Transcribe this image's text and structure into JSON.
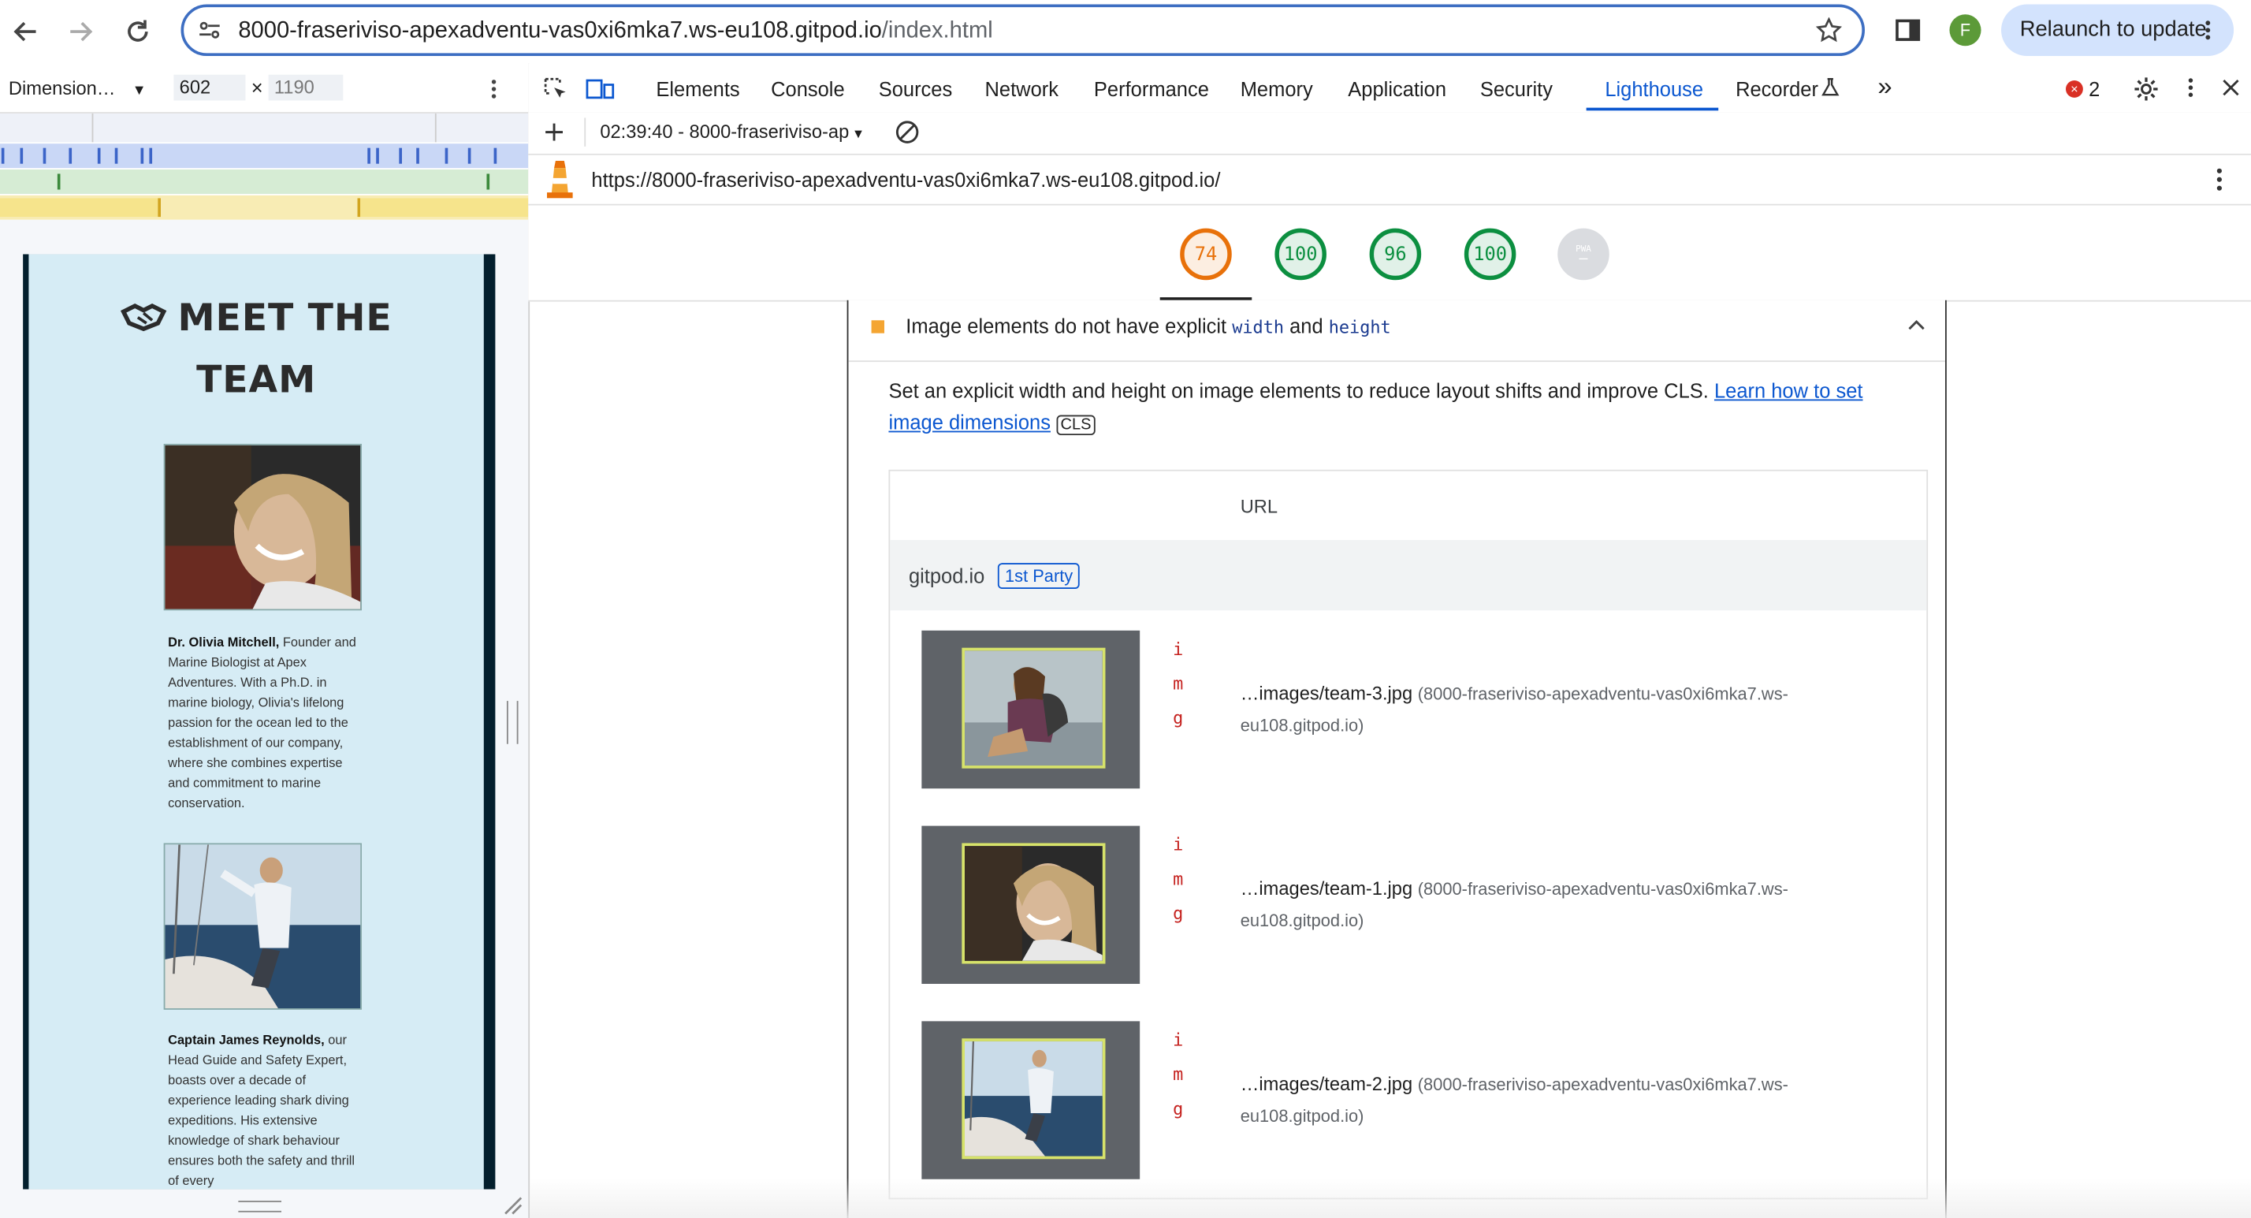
{
  "browser": {
    "url_host": "8000-fraseriviso-apexadventu-vas0xi6mka7.ws-eu108.gitpod.io",
    "url_path": "/index.html",
    "avatar_letter": "F",
    "relaunch_label": "Relaunch to update"
  },
  "device_toolbar": {
    "preset": "Dimension…",
    "width": "602",
    "times": "×",
    "height": "1190"
  },
  "devtools": {
    "tabs": [
      "Elements",
      "Console",
      "Sources",
      "Network",
      "Performance",
      "Memory",
      "Application",
      "Security",
      "Lighthouse",
      "Recorder"
    ],
    "active_tab": "Lighthouse",
    "more_tabs": "»",
    "error_count": "2",
    "report_select": "02:39:40 - 8000-fraseriviso-ap",
    "report_url": "https://8000-fraseriviso-apexadventu-vas0xi6mka7.ws-eu108.gitpod.io/"
  },
  "scores": [
    {
      "value": "74",
      "color": "#e8710a"
    },
    {
      "value": "100",
      "color": "#0c8f40"
    },
    {
      "value": "96",
      "color": "#0c8f40"
    },
    {
      "value": "100",
      "color": "#0c8f40"
    },
    {
      "value": "PWA",
      "color": "#9aa0a6"
    }
  ],
  "audit": {
    "title_prefix": "Image elements do not have explicit",
    "code_width": "width",
    "and": "and",
    "code_height": "height",
    "description": "Set an explicit width and height on image elements to reduce layout shifts and improve CLS.",
    "link_text": "Learn how to set image dimensions",
    "cls_badge": "CLS",
    "column_header": "URL",
    "group_name": "gitpod.io",
    "group_badge": "1st Party",
    "node_tag": "img",
    "rows": [
      {
        "url": "…images/team-3.jpg",
        "source": "(8000-fraseriviso-apexadventu-vas0xi6mka7.ws-eu108.gitpod.io)"
      },
      {
        "url": "…images/team-1.jpg",
        "source": "(8000-fraseriviso-apexadventu-vas0xi6mka7.ws-eu108.gitpod.io)"
      },
      {
        "url": "…images/team-2.jpg",
        "source": "(8000-fraseriviso-apexadventu-vas0xi6mka7.ws-eu108.gitpod.io)"
      }
    ]
  },
  "preview": {
    "title_icon": "handshake-icon",
    "title_line1": "MEET THE",
    "title_line2": "TEAM",
    "member1_name": "Dr. Olivia Mitchell,",
    "member1_bio": "Founder and Marine Biologist at Apex Adventures. With a Ph.D. in marine biology, Olivia's lifelong passion for the ocean led to the establishment of our company, where she combines expertise and commitment to marine conservation.",
    "member2_name": "Captain James Reynolds,",
    "member2_bio": "our Head Guide and Safety Expert, boasts over a decade of experience leading shark diving expeditions. His extensive knowledge of shark behaviour ensures both the safety and thrill of every"
  }
}
